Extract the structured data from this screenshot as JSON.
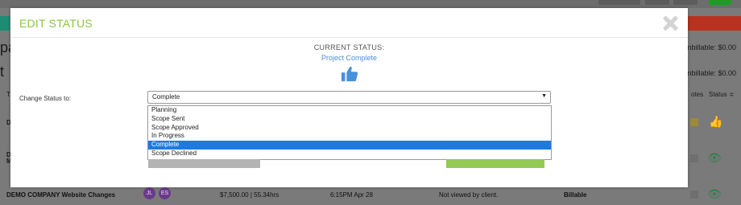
{
  "modal": {
    "title": "EDIT STATUS",
    "current_status_label": "CURRENT STATUS:",
    "current_status_value": "Project Complete",
    "current_status_icon": "thumbs-up-icon",
    "change_label": "Change Status to:",
    "select_value": "Complete",
    "options": [
      "Planning",
      "Scope Sent",
      "Scope Approved",
      "In Progress",
      "Complete",
      "Scope Declined"
    ],
    "selected_option": "Complete"
  },
  "background": {
    "left_partial_1": "pa",
    "left_partial_2": "t",
    "unbillable_1": "Jnbillable: $0.00",
    "unbillable_2": "Jnbillable: $0.00",
    "header_notes": "otes",
    "header_status": "Status ≑",
    "row_letter_1": "D",
    "row_letter_2": "D",
    "row_letter_3": "M",
    "row": {
      "name": "DEMO COMPANY Website Changes",
      "avatars": [
        "JL",
        "ES"
      ],
      "amount": "$7,500.00 | 55.34hrs",
      "time": "6:15PM Apr 28",
      "view_status": "Not viewed by client.",
      "billing": "Billable"
    }
  },
  "colors": {
    "title": "#8cc63f",
    "link_blue": "#4a90d9",
    "selected_option_bg": "#1e7ae0",
    "save_button": "#95c955",
    "cancel_button": "#b4b4b4"
  }
}
